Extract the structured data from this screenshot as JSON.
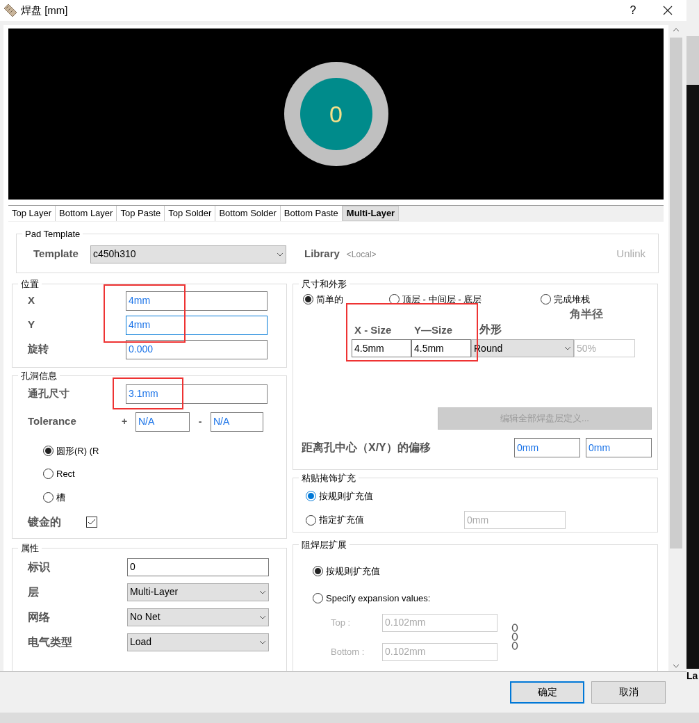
{
  "window": {
    "title": "焊盘 [mm]",
    "help": "?"
  },
  "preview": {
    "designator": "0"
  },
  "tabs": [
    {
      "label": "Top Layer",
      "selected": false
    },
    {
      "label": "Bottom Layer",
      "selected": false
    },
    {
      "label": "Top Paste",
      "selected": false
    },
    {
      "label": "Top Solder",
      "selected": false
    },
    {
      "label": "Bottom Solder",
      "selected": false
    },
    {
      "label": "Bottom Paste",
      "selected": false
    },
    {
      "label": "Multi-Layer",
      "selected": true
    }
  ],
  "pad_template": {
    "title": "Pad Template",
    "template_label": "Template",
    "template": "c450h310",
    "library_label": "Library",
    "library": "<Local>",
    "unlink": "Unlink"
  },
  "location": {
    "title": "位置",
    "fields": [
      {
        "label": "X",
        "value": "4mm",
        "focused": false
      },
      {
        "label": "Y",
        "value": "4mm",
        "focused": true
      },
      {
        "label": "旋转",
        "value": "0.000",
        "focused": false
      }
    ]
  },
  "hole": {
    "title": "孔洞信息",
    "size_label": "通孔尺寸",
    "size": "3.1mm",
    "tolerance_label": "Tolerance",
    "plus": "+",
    "plus_value": "N/A",
    "minus": "-",
    "minus_value": "N/A",
    "shapes": [
      {
        "label": "圆形(R) (R",
        "selected": true
      },
      {
        "label": "Rect",
        "selected": false
      },
      {
        "label": "槽",
        "selected": false
      }
    ],
    "plated_label": "镀金的",
    "plated": true
  },
  "properties": {
    "title": "属性",
    "rows": [
      {
        "kind": "text",
        "label": "标识",
        "value": "0"
      },
      {
        "kind": "select",
        "label": "层",
        "value": "Multi-Layer"
      },
      {
        "kind": "select",
        "label": "网络",
        "value": "No Net"
      },
      {
        "kind": "select",
        "label": "电气类型",
        "value": "Load"
      }
    ]
  },
  "size_shape": {
    "title": "尺寸和外形",
    "modes": [
      {
        "label": "简单的",
        "selected": true
      },
      {
        "label": "顶层 - 中间层 - 底层",
        "selected": false
      },
      {
        "label": "完成堆栈",
        "selected": false
      }
    ],
    "corner_label": "角半径",
    "x_size_label": "X - Size",
    "y_size_label": "Y—Size",
    "shape_label": "外形",
    "x_size": "4.5mm",
    "y_size": "4.5mm",
    "shape": "Round",
    "corner": "50%",
    "edit_button": "编辑全部焊盘层定义...",
    "offset_label": "距离孔中心（X/Y）的偏移",
    "offset_x": "0mm",
    "offset_y": "0mm"
  },
  "paste": {
    "title": "粘贴掩饰扩充",
    "options": [
      {
        "label": "按规则扩充值",
        "selected": true
      },
      {
        "label": "指定扩充值",
        "selected": false
      }
    ],
    "value": "0mm"
  },
  "solder": {
    "title": "阻焊层扩展",
    "options": [
      {
        "label": "按规则扩充值",
        "selected": true
      },
      {
        "label": "Specify expansion values:",
        "selected": false
      }
    ],
    "top_label": "Top :",
    "top": "0.102mm",
    "bottom_label": "Bottom :",
    "bottom": "0.102mm"
  },
  "buttons": [
    {
      "label": "确定",
      "default": true
    },
    {
      "label": "取消",
      "default": false
    }
  ],
  "background_window": {
    "text": "La"
  }
}
